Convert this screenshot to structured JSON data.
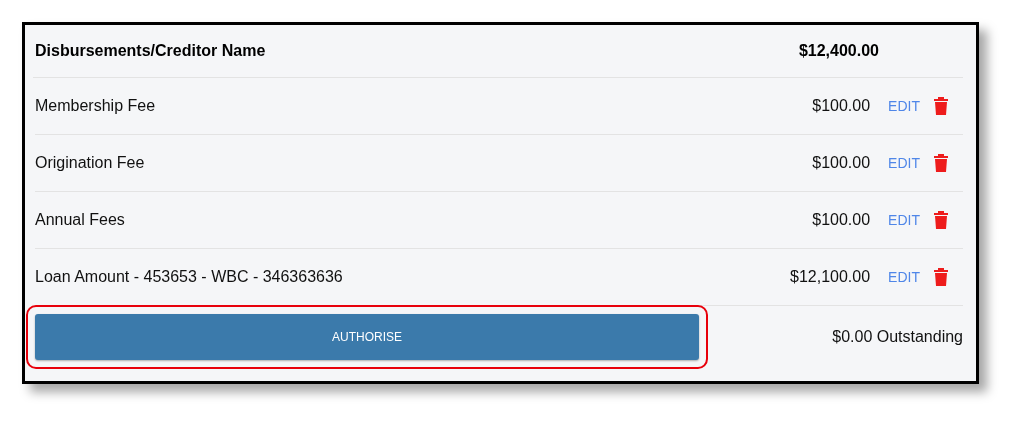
{
  "header": {
    "title": "Disbursements/Creditor Name",
    "total": "$12,400.00"
  },
  "rows": [
    {
      "name": "Membership Fee",
      "amount": "$100.00",
      "action": "EDIT"
    },
    {
      "name": "Origination Fee",
      "amount": "$100.00",
      "action": "EDIT"
    },
    {
      "name": "Annual Fees",
      "amount": "$100.00",
      "action": "EDIT"
    },
    {
      "name": "Loan Amount - 453653 - WBC - 346363636",
      "amount": "$12,100.00",
      "action": "EDIT"
    }
  ],
  "footer": {
    "button": "AUTHORISE",
    "highlighted": true,
    "outstanding": "$0.00 Outstanding"
  }
}
